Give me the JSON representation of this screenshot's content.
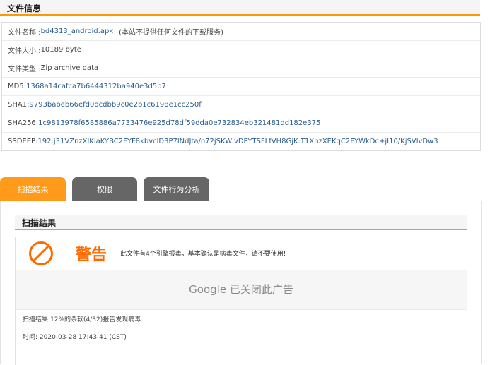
{
  "file_info": {
    "title": "文件信息",
    "rows": [
      {
        "label": "文件名称 :",
        "value": "bd4313_android.apk",
        "note": "(本站不提供任何文件的下载服务)"
      },
      {
        "label": "文件大小 :",
        "value": "10189 byte"
      },
      {
        "label": "文件类型 :",
        "value": "Zip archive data"
      },
      {
        "label": "MD5:",
        "value": "1368a14cafca7b6444312ba940e3d5b7"
      },
      {
        "label": "SHA1:",
        "value": "9793babeb66efd0dcdbb9c0e2b1c6198e1cc250f"
      },
      {
        "label": "SHA256:",
        "value": "1c9813978f6585886a7733476e925d78df59dda0e732834eb321481dd182e375"
      },
      {
        "label": "SSDEEP:",
        "value": "192:j31VZnzXlKiaKYBC2FYF8kbvclD3P7lNdJta/n72jSKWlvDPYTSFLfVH8GjK:T1XnzXEKqC2FYWkDc+jI10/KjSVlvDw3"
      }
    ]
  },
  "tabs": [
    {
      "label": "扫描结果",
      "active": true
    },
    {
      "label": "权限",
      "active": false
    },
    {
      "label": "文件行为分析",
      "active": false
    }
  ],
  "scan": {
    "title": "扫描结果",
    "warning_title": "警告",
    "warning_text": "此文件有4个引擎报毒，基本确认是病毒文件，请不要使用!",
    "ad_text": "Google 已关闭此广告",
    "result": "扫描结果:12%的杀软(4/32)报告发现病毒",
    "time": "时间: 2020-03-28 17:43:41 (CST)"
  },
  "colors": {
    "accent": "#ff9900",
    "warning": "#ff6a00",
    "tab_inactive": "#666666",
    "link": "#2a5d8f"
  },
  "icons": {
    "warning": "ban-icon"
  }
}
